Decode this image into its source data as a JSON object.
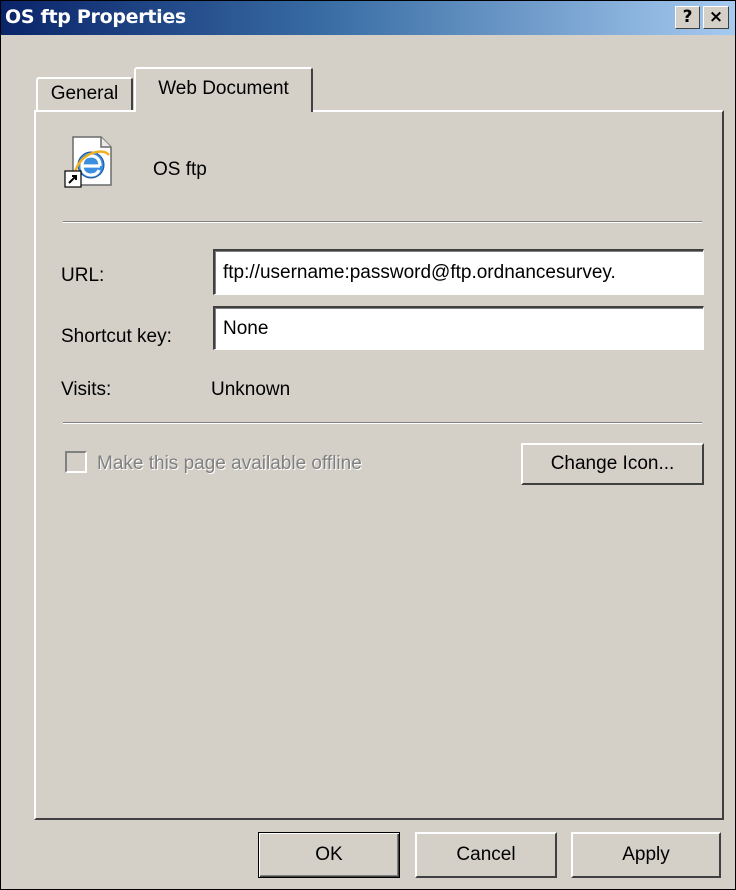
{
  "window": {
    "title": "OS ftp Properties",
    "help_button": "?",
    "close_button": "×"
  },
  "tabs": [
    {
      "label": "General",
      "selected": false
    },
    {
      "label": "Web Document",
      "selected": true
    }
  ],
  "document": {
    "name": "OS ftp",
    "icon": "internet-shortcut-icon"
  },
  "fields": {
    "url_label": "URL:",
    "url_value": "ftp://username:password@ftp.ordnancesurvey.",
    "shortcut_label": "Shortcut key:",
    "shortcut_value": "None",
    "visits_label": "Visits:",
    "visits_value": "Unknown"
  },
  "offline": {
    "label": "Make this page available offline",
    "checked": false,
    "enabled": false
  },
  "buttons": {
    "change_icon": "Change Icon...",
    "ok": "OK",
    "cancel": "Cancel",
    "apply": "Apply"
  },
  "colors": {
    "face": "#d4d0c8",
    "title_start": "#0a246a",
    "title_end": "#a6caf0",
    "disabled_text": "#808080"
  }
}
